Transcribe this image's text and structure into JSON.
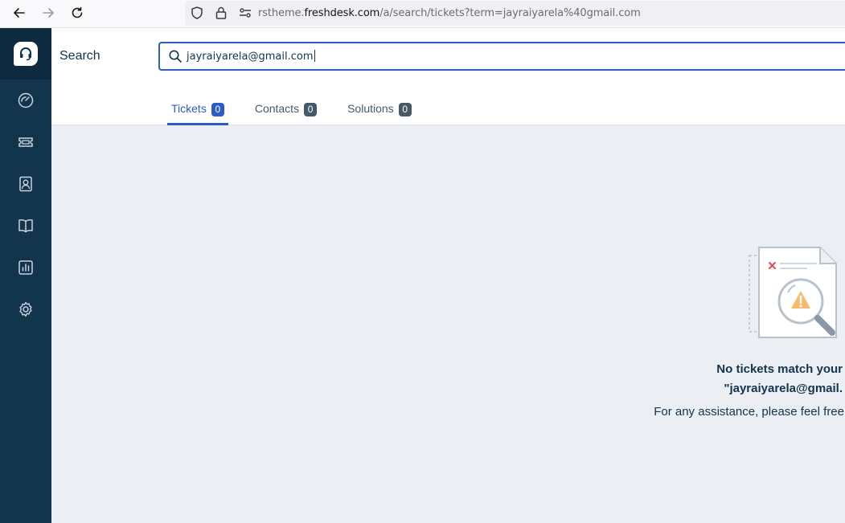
{
  "browser": {
    "url_prefix": "rstheme.",
    "url_host": "freshdesk.com",
    "url_path": "/a/search/tickets?term=jayraiyarela%40gmail.com"
  },
  "sidebar": {
    "items": [
      {
        "name": "dashboard"
      },
      {
        "name": "tickets"
      },
      {
        "name": "contacts"
      },
      {
        "name": "solutions"
      },
      {
        "name": "analytics"
      },
      {
        "name": "admin"
      }
    ]
  },
  "header": {
    "title": "Search",
    "search_value": "jayraiyarela@gmail.com"
  },
  "tabs": [
    {
      "label": "Tickets",
      "count": "0"
    },
    {
      "label": "Contacts",
      "count": "0"
    },
    {
      "label": "Solutions",
      "count": "0"
    }
  ],
  "empty_state": {
    "title_line1": "No tickets match your",
    "title_line2": "\"jayraiyarela@gmail.",
    "subtitle": "For any assistance, please feel free"
  },
  "colors": {
    "sidebar": "#12344d",
    "accent": "#2c5cc5",
    "background": "#ebeff3"
  }
}
